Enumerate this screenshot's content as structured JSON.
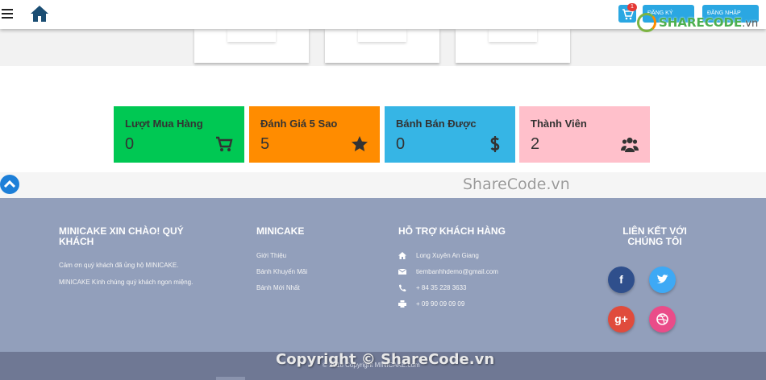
{
  "navbar": {
    "cart_count": "1",
    "button_1": "ĐĂNG KÝ",
    "button_2": "ĐĂNG NHẬP"
  },
  "watermark": {
    "logo_main": "SHARECODE",
    "logo_suffix": ".vn",
    "middle": "ShareCode.vn",
    "bottom": "Copyright © ShareCode.vn"
  },
  "stats": [
    {
      "label": "Lượt Mua Hàng",
      "value": "0",
      "icon": "cart-icon",
      "color": "#00c853"
    },
    {
      "label": "Đánh Giá 5 Sao",
      "value": "5",
      "icon": "star-icon",
      "color": "#ff8c00"
    },
    {
      "label": "Bánh Bán Được",
      "value": "0",
      "icon": "dollar-icon",
      "color": "#36b5e5"
    },
    {
      "label": "Thành Viên",
      "value": "2",
      "icon": "users-icon",
      "color": "#ffc0cb"
    }
  ],
  "footer": {
    "col1": {
      "title": "MINICAKE XIN CHÀO! QUÝ KHÁCH",
      "line1": "Cảm ơn quý khách đã ủng hộ MINICAKE.",
      "line2": "MINICAKE Kính chúng quý khách ngon miệng."
    },
    "col2": {
      "title": "MINICAKE",
      "links": [
        "Giới Thiệu",
        "Bánh Khuyến Mãi",
        "Bánh Mới Nhất"
      ]
    },
    "col3": {
      "title": "HỖ TRỢ KHÁCH HÀNG",
      "address": "Long Xuyên An Giang",
      "email": "tiembanhhdemo@gmail.com",
      "phone": "+ 84 35 228 3633",
      "fax": "+ 09 90 09 09 09"
    },
    "col4": {
      "title": "LIÊN KẾT VỚI CHÚNG TÔI",
      "social": [
        "facebook-icon",
        "twitter-icon",
        "google-plus-icon",
        "dribbble-icon"
      ]
    },
    "copyright": "© 2018 Copyright MINICAKE.com"
  },
  "colors": {
    "footer_bg": "#929fbb",
    "bottom_bar": "#6f7894",
    "accent": "#2aa7e2"
  }
}
